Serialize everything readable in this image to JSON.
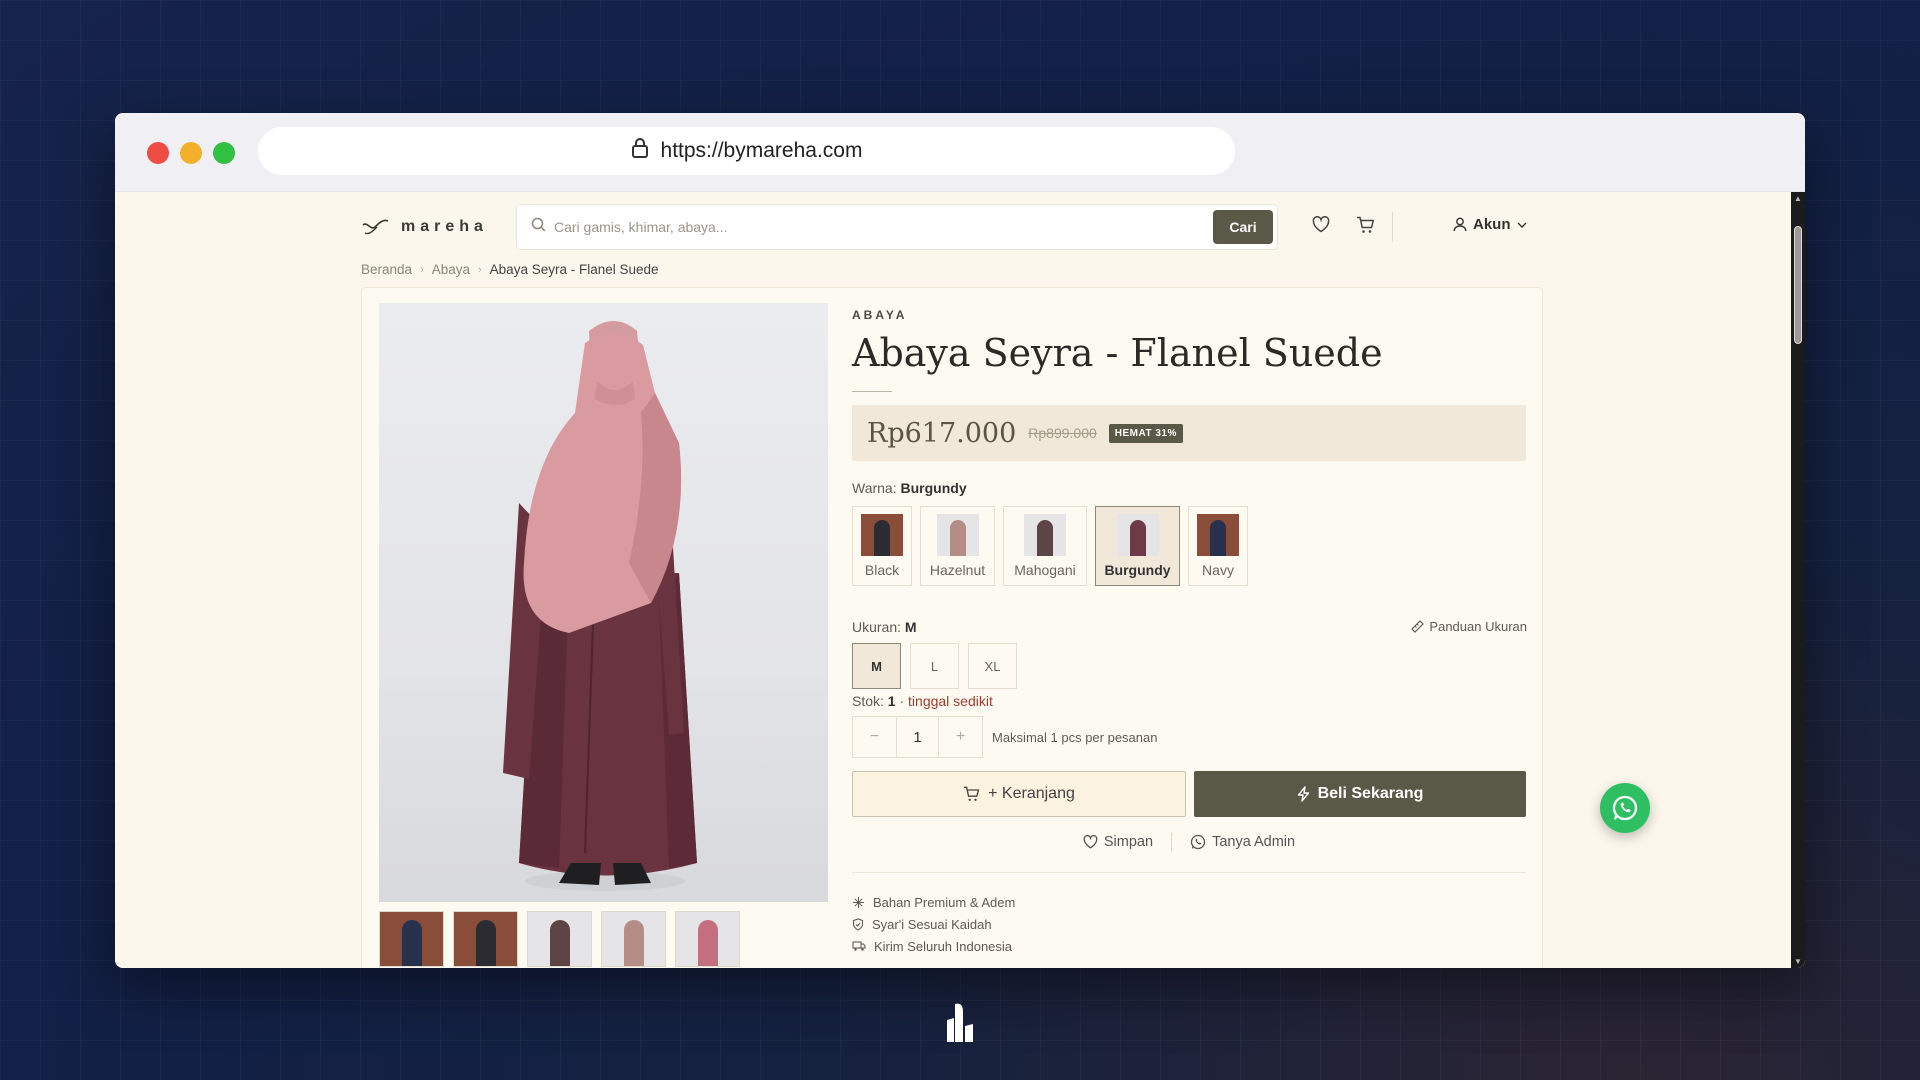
{
  "browser": {
    "url": "https://bymareha.com"
  },
  "header": {
    "logo_text": "mareha",
    "search_placeholder": "Cari gamis, khimar, abaya...",
    "search_button": "Cari",
    "account_label": "Akun"
  },
  "breadcrumb": [
    "Beranda",
    "Abaya",
    "Abaya Seyra - Flanel Suede"
  ],
  "product": {
    "category": "ABAYA",
    "title": "Abaya Seyra - Flanel Suede",
    "price": "Rp617.000",
    "price_old": "Rp899.000",
    "discount_badge": "HEMAT 31%",
    "color_label": "Warna:",
    "selected_color": "Burgundy",
    "colors": [
      {
        "name": "Black",
        "swatch": "#2b2b33",
        "bg": "#8a4d3a"
      },
      {
        "name": "Hazelnut",
        "swatch": "#b58c86",
        "bg": "#e5e4e7"
      },
      {
        "name": "Mahogani",
        "swatch": "#5d4545",
        "bg": "#e5e4e7"
      },
      {
        "name": "Burgundy",
        "swatch": "#6e3a47",
        "bg": "#e5e4e7"
      },
      {
        "name": "Navy",
        "swatch": "#27304d",
        "bg": "#8a4d3a"
      }
    ],
    "size_label": "Ukuran:",
    "selected_size": "M",
    "size_guide": "Panduan Ukuran",
    "sizes": [
      "M",
      "L",
      "XL"
    ],
    "stock_label": "Stok:",
    "stock_value": "1",
    "stock_note": "· tinggal sedikit",
    "quantity": "1",
    "quantity_note": "Maksimal 1 pcs per pesanan",
    "add_to_cart": "+ Keranjang",
    "buy_now": "Beli Sekarang",
    "save_label": "Simpan",
    "ask_admin_label": "Tanya Admin",
    "features": [
      "Bahan Premium & Adem",
      "Syar'i Sesuai Kaidah",
      "Kirim Seluruh Indonesia"
    ]
  },
  "thumbnails": [
    {
      "bg": "#8a4d3a",
      "fig": "#27304d"
    },
    {
      "bg": "#8a4d3a",
      "fig": "#2b2b33"
    },
    {
      "bg": "#e5e4e7",
      "fig": "#5d4545"
    },
    {
      "bg": "#e5e4e7",
      "fig": "#b58c86"
    },
    {
      "bg": "#e5e4e7",
      "fig": "#c46f7f"
    }
  ],
  "colors": {
    "accent": "#5a5847",
    "page_bg": "#fbf7ec",
    "low_stock": "#a23b2d",
    "whatsapp": "#2dbf62"
  }
}
